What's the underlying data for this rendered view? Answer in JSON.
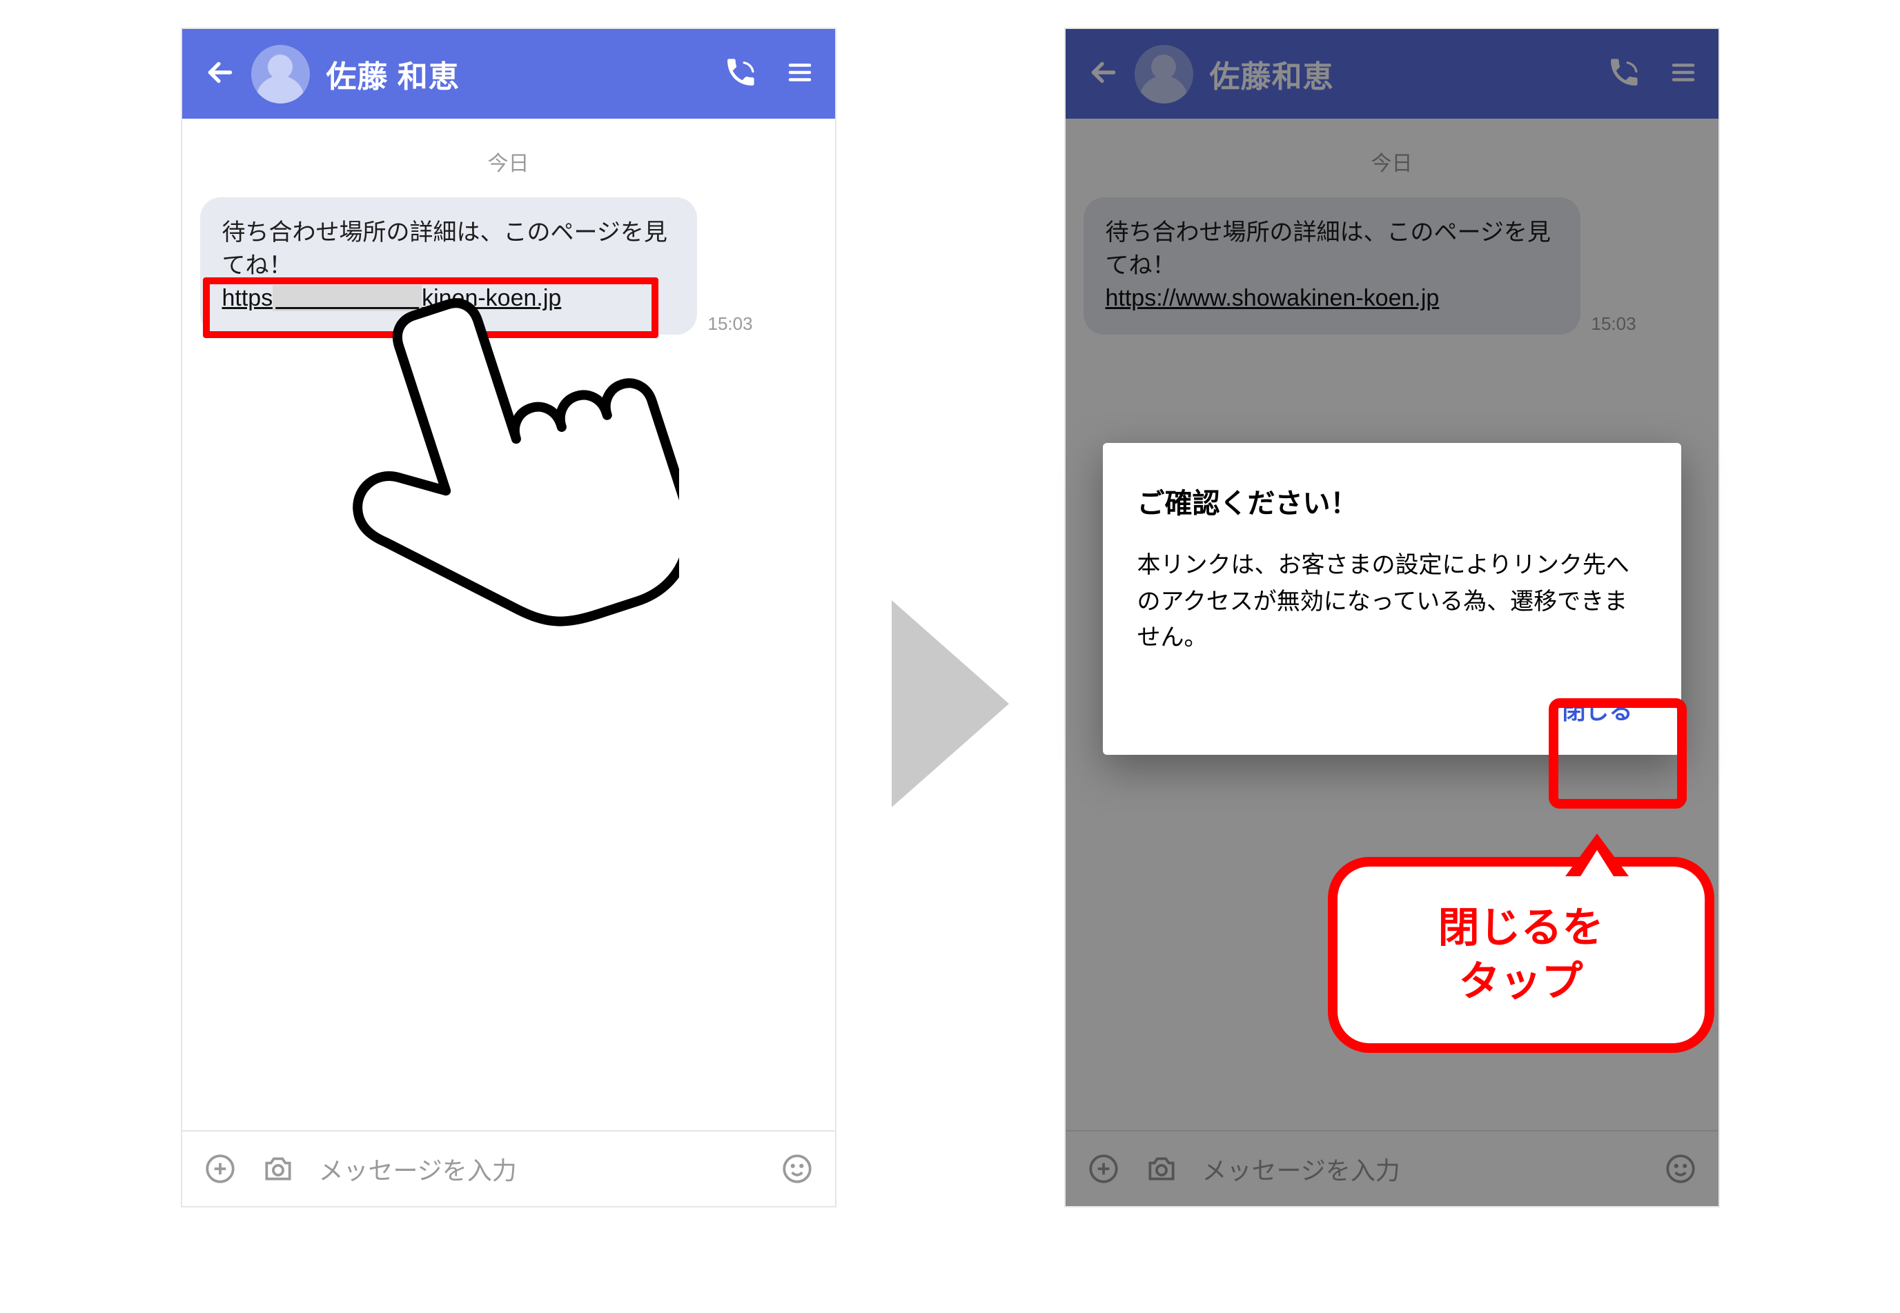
{
  "screens": {
    "left": {
      "header": {
        "contact_name": "佐藤 和恵"
      },
      "date_separator": "今日",
      "message": {
        "text": "待ち合わせ場所の詳細は、このページを見てね！",
        "url_prefix": "https",
        "url_suffix": "kinen-koen.jp",
        "time": "15:03"
      },
      "input_placeholder": "メッセージを入力"
    },
    "right": {
      "header": {
        "contact_name": "佐藤和恵"
      },
      "date_separator": "今日",
      "message": {
        "text": "待ち合わせ場所の詳細は、このページを見てね！",
        "url": "https://www.showakinen-koen.jp",
        "time": "15:03"
      },
      "dialog": {
        "title": "ご確認ください！",
        "body": "本リンクは、お客さまの設定によりリンク先へのアクセスが無効になっている為、遷移できません。",
        "close_label": "閉じる"
      },
      "callout": "閉じるを\nタップ",
      "input_placeholder": "メッセージを入力"
    }
  }
}
